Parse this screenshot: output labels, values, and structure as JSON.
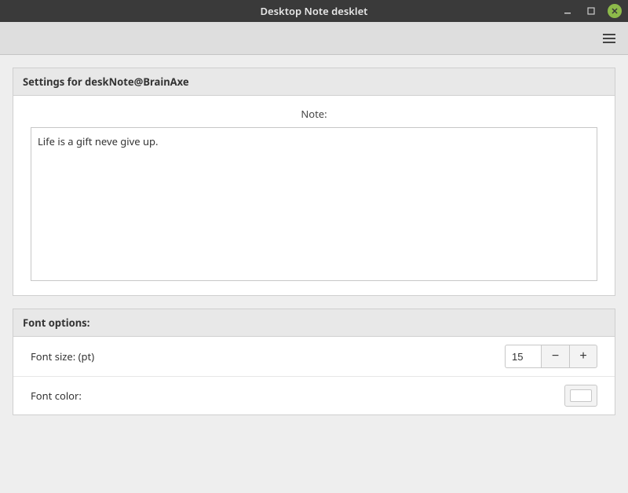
{
  "window": {
    "title": "Desktop Note desklet"
  },
  "panels": {
    "settings": {
      "title": "Settings for deskNote@BrainAxe",
      "note_label": "Note:",
      "note_value": "Life is a gift neve give up."
    },
    "font": {
      "title": "Font options:",
      "size_label": "Font size: (pt)",
      "size_value": "15",
      "color_label": "Font color:",
      "color_value": "#ffffff"
    }
  },
  "icons": {
    "minus": "−",
    "plus": "+"
  }
}
